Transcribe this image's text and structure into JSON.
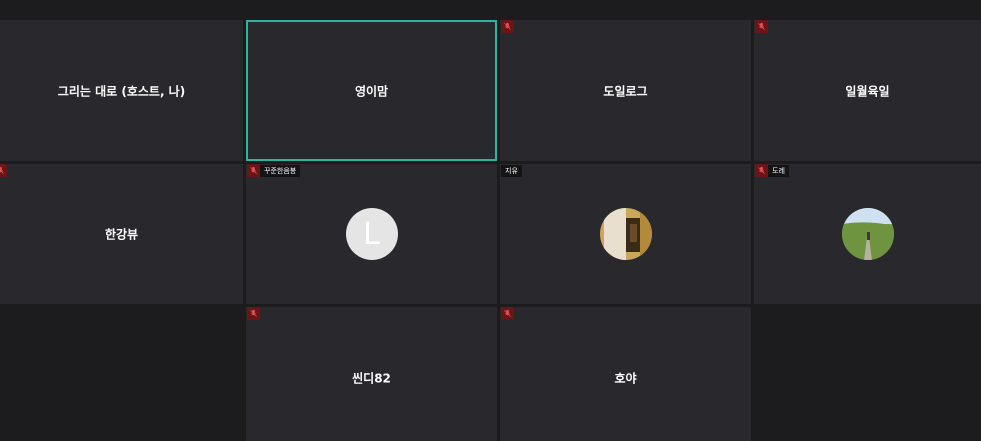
{
  "participants": [
    {
      "name": "그리는 대로 (호스트, 나)"
    },
    {
      "name": "영이맘"
    },
    {
      "name": "도일로그"
    },
    {
      "name": "일월육일"
    },
    {
      "name": "한강뷰"
    },
    {
      "name": "꾸준한음봉",
      "avatar_letter": "L"
    },
    {
      "name": "지유"
    },
    {
      "name": "도레"
    },
    {
      "name": "씬디82"
    },
    {
      "name": "호야"
    }
  ],
  "icons": {
    "muted": "mic-muted-icon"
  },
  "colors": {
    "background": "#1c1c1f",
    "tile": "#28282d",
    "active_speaker_border": "#2bb6a3",
    "muted_badge": "#6a1518"
  }
}
